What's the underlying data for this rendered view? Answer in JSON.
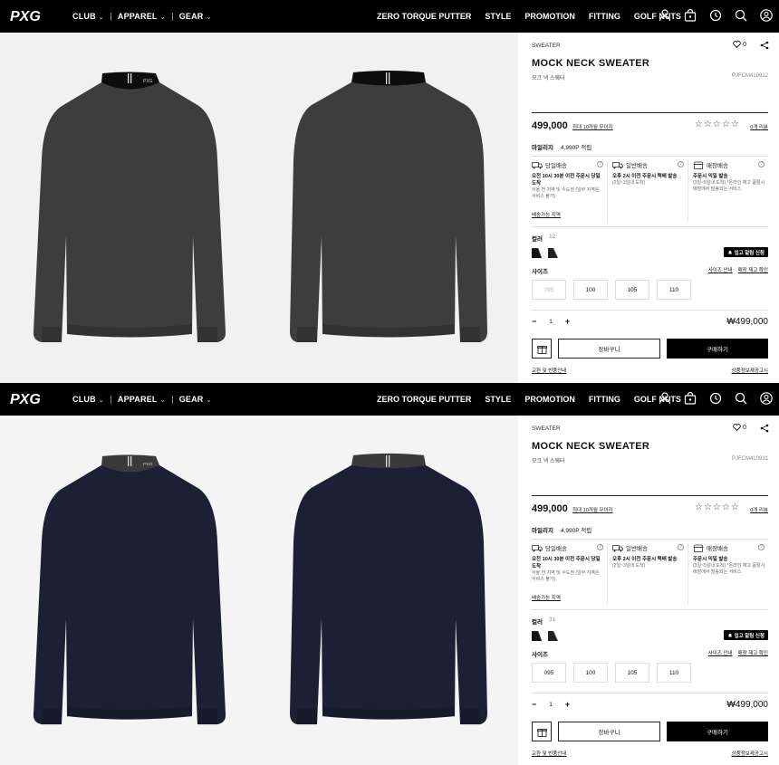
{
  "nav": {
    "logo_text": "PXG",
    "left_menu": [
      "CLUB",
      "APPAREL",
      "GEAR"
    ],
    "right_menu": [
      "ZERO TORQUE PUTTER",
      "STYLE",
      "PROMOTION",
      "FITTING",
      "GOLF NUTS"
    ],
    "icons": [
      "user-icon",
      "bag-icon",
      "history-icon",
      "search-icon",
      "account-icon"
    ]
  },
  "panels": [
    {
      "sweater_color": "#3d3d3d",
      "collar_color": "#0d0d0d",
      "product": {
        "category": "SWEATER",
        "name": "MOCK NECK SWEATER",
        "name_kr": "모크 넥 스웨터",
        "code": "PJFCM410912",
        "likes": "0",
        "price": "499,000",
        "installment": "최대 10개월 무이자",
        "stars": "☆☆☆☆☆",
        "reviews": "0개 리뷰",
        "mileage_label": "마일리지",
        "mileage_value": "4,990P 적립",
        "color_label": "컬러",
        "color_value": "12",
        "restock": "입고 알림 신청",
        "size_label": "사이즈",
        "size_guide": "사이즈 안내",
        "store_stock": "매장 재고 확인",
        "sizes": [
          "095",
          "100",
          "105",
          "110"
        ],
        "qty": "1",
        "total": "₩499,000",
        "cart": "장바구니",
        "buy": "구매하기",
        "exchange": "교환 및 반품안내",
        "product_info": "상품정보제공고시"
      },
      "shipping": [
        {
          "title": "당일배송",
          "bold": "오전 10시 30분 이전 주문시 당일도착",
          "sub": "서울 전 지역 및 수도권 (일부 지역은 서비스 불가)",
          "link": "배송가능 지역"
        },
        {
          "title": "일반배송",
          "bold": "오후 2시 이전 주문시 택배 발송",
          "sub": "(2일~3일내 도착)",
          "link": ""
        },
        {
          "title": "매장배송",
          "bold": "주문시 익일 발송",
          "sub": "(3일~5일내 도착) *온라인 재고 품절시 매장에서 발송되는 서비스",
          "link": ""
        }
      ]
    },
    {
      "sweater_color": "#1d2035",
      "collar_color": "#3a3a3a",
      "product": {
        "category": "SWEATER",
        "name": "MOCK NECK SWEATER",
        "name_kr": "모크 넥 스웨터",
        "code": "PJFCM410931",
        "likes": "0",
        "price": "499,000",
        "installment": "최대 10개월 무이자",
        "stars": "☆☆☆☆☆",
        "reviews": "0개 리뷰",
        "mileage_label": "마일리지",
        "mileage_value": "4,990P 적립",
        "color_label": "컬러",
        "color_value": "31",
        "restock": "입고 알림 신청",
        "size_label": "사이즈",
        "size_guide": "사이즈 안내",
        "store_stock": "매장 재고 확인",
        "sizes": [
          "095",
          "100",
          "105",
          "110"
        ],
        "qty": "1",
        "total": "₩499,000",
        "cart": "장바구니",
        "buy": "구매하기",
        "exchange": "교환 및 반품안내",
        "product_info": "상품정보제공고시"
      },
      "shipping": [
        {
          "title": "당일배송",
          "bold": "오전 10시 30분 이전 주문시 당일도착",
          "sub": "서울 전 지역 및 수도권 (일부 지역은 서비스 불가)",
          "link": "배송가능 지역"
        },
        {
          "title": "일반배송",
          "bold": "오후 2시 이전 주문시 택배 발송",
          "sub": "(2일~3일내 도착)",
          "link": ""
        },
        {
          "title": "매장배송",
          "bold": "주문시 익일 발송",
          "sub": "(3일~5일내 도착) *온라인 재고 품절시 매장에서 발송되는 서비스",
          "link": ""
        }
      ]
    }
  ]
}
